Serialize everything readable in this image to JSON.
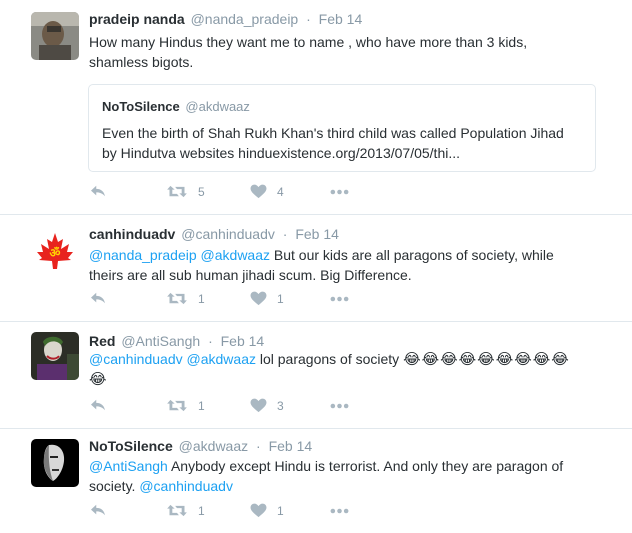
{
  "tweets": [
    {
      "name": "pradeip nanda",
      "handle": "@nanda_pradeip",
      "time": "Feb 14",
      "text_line1": "How many Hindus they want me to name , who have more than 3 kids,",
      "text_line2": "shamless bigots.",
      "quote": {
        "name": "NoToSilence",
        "handle": "@akdwaaz",
        "text_line1": "Even the birth of Shah Rukh Khan's third child was called Population Jihad",
        "text_line2": "by Hindutva websites hinduexistence.org/2013/07/05/thi..."
      },
      "retweets": "5",
      "likes": "4"
    },
    {
      "name": "canhinduadv",
      "handle": "@canhinduadv",
      "time": "Feb 14",
      "mention1": "@nanda_pradeip",
      "mention2": "@akdwaaz",
      "text_line1_rest": "But our kids are all paragons of society, while",
      "text_line2": "theirs are all sub human jihadi scum. Big Difference.",
      "retweets": "1",
      "likes": "1"
    },
    {
      "name": "Red",
      "handle": "@AntiSangh",
      "time": "Feb 14",
      "mention1": "@canhinduadv",
      "mention2": "@akdwaaz",
      "text_rest": "lol paragons of society",
      "emoji_line1": "😂😂😂😂😂😂😂😂😂",
      "emoji_line2": "😂",
      "retweets": "1",
      "likes": "3"
    },
    {
      "name": "NoToSilence",
      "handle": "@akdwaaz",
      "time": "Feb 14",
      "mention1": "@AntiSangh",
      "text_line1_rest": "Anybody except Hindu is terrorist. And only they are paragon of",
      "text_line2": "society.",
      "mention2": "@canhinduadv",
      "retweets": "1",
      "likes": "1"
    }
  ],
  "icons": {
    "reply": "reply-icon",
    "retweet": "retweet-icon",
    "like": "heart-icon",
    "more": "more-icon"
  },
  "colors": {
    "mention": "#1da1f2",
    "muted": "#8899a6",
    "icon": "#aab8c2",
    "separator": "#e1e8ed"
  }
}
